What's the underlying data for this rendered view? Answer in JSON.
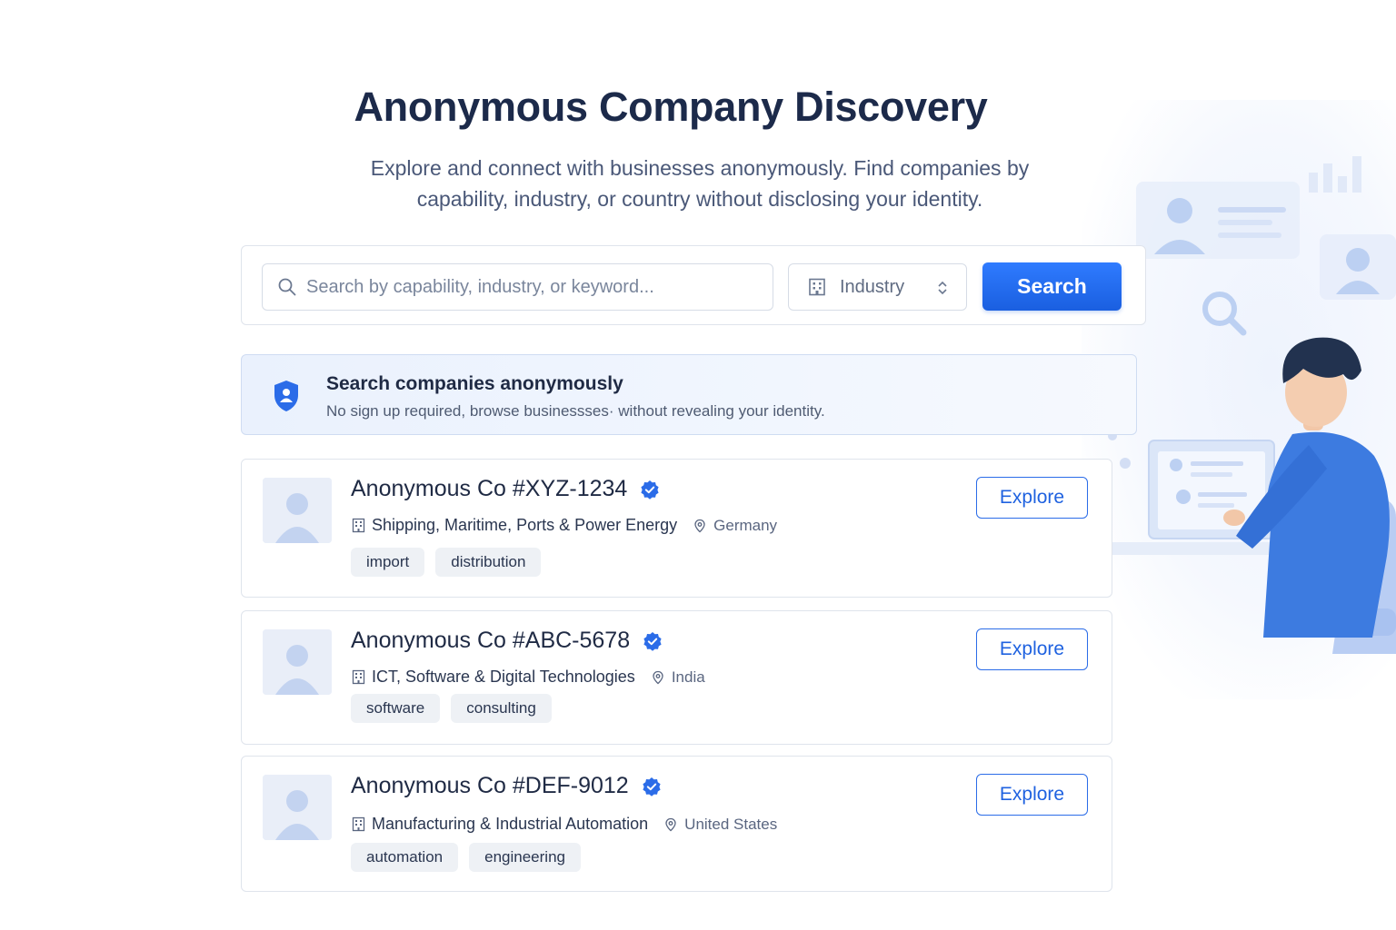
{
  "header": {
    "title": "Anonymous Company Discovery",
    "subtitle": "Explore and connect with businesses anonymously. Find companies by capability, industry, or country without disclosing your identity."
  },
  "search": {
    "placeholder": "Search by capability, industry, or keyword...",
    "value": "",
    "industry_label": "Industry",
    "button_label": "Search"
  },
  "banner": {
    "title": "Search companies anonymously",
    "text": "No sign up required, browse businessses· without revealing your identity."
  },
  "companies": [
    {
      "name": "Anonymous Co #XYZ-1234",
      "industry": "Shipping, Maritime, Ports & Power Energy",
      "country": "Germany",
      "tags": [
        "import",
        "distribution"
      ],
      "action_label": "Explore"
    },
    {
      "name": "Anonymous Co #ABC-5678",
      "industry": "ICT, Software & Digital Technologies",
      "country": "India",
      "tags": [
        "software",
        "consulting"
      ],
      "action_label": "Explore"
    },
    {
      "name": "Anonymous Co #DEF-9012",
      "industry": "Manufacturing & Industrial Automation",
      "country": "United States",
      "tags": [
        "automation",
        "engineering"
      ],
      "action_label": "Explore"
    }
  ],
  "icons": {
    "search": "search-icon",
    "industry": "building-icon",
    "select": "chevron-updown-icon",
    "banner": "shield-user-icon",
    "verified": "verified-badge-icon",
    "location": "map-pin-icon",
    "avatar": "user-placeholder-icon"
  },
  "colors": {
    "primary": "#1a5fe0",
    "title": "#1c2a4a",
    "banner_bg": "#eaf1fd",
    "tag_bg": "#eef1f5",
    "verified": "#2b6ce8"
  }
}
